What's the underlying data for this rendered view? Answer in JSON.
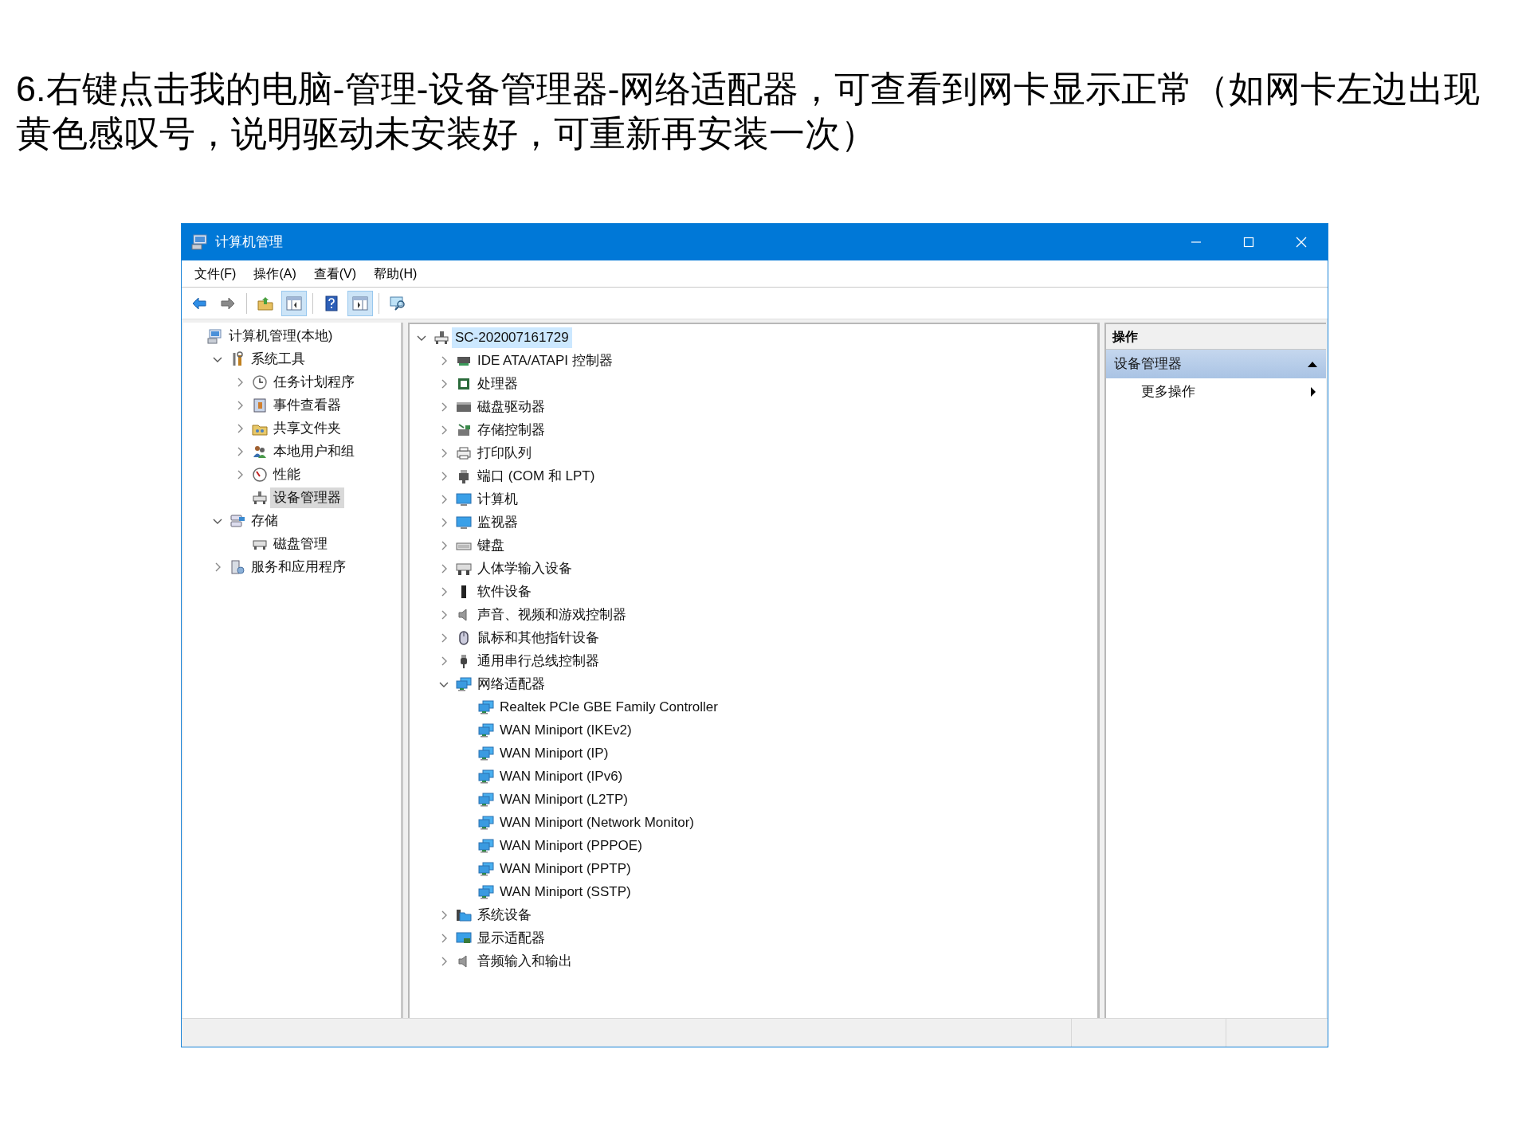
{
  "instruction": "6.右键点击我的电脑-管理-设备管理器-网络适配器，可查看到网卡显示正常（如网卡左边出现黄色感叹号，说明驱动未安装好，可重新再安装一次）",
  "window": {
    "title": "计算机管理"
  },
  "menu": [
    {
      "label": "文件(F)"
    },
    {
      "label": "操作(A)"
    },
    {
      "label": "查看(V)"
    },
    {
      "label": "帮助(H)"
    }
  ],
  "toolbar": [
    {
      "kind": "back",
      "pressed": false
    },
    {
      "kind": "forward",
      "pressed": false
    },
    {
      "kind": "separator"
    },
    {
      "kind": "up",
      "pressed": false
    },
    {
      "kind": "tree",
      "pressed": true
    },
    {
      "kind": "separator"
    },
    {
      "kind": "help",
      "pressed": false
    },
    {
      "kind": "action-pane",
      "pressed": true
    },
    {
      "kind": "separator"
    },
    {
      "kind": "scan",
      "pressed": false
    }
  ],
  "console_tree": [
    {
      "label": "计算机管理(本地)",
      "selected": false,
      "children": [
        {
          "label": "系统工具",
          "expanded": true,
          "selected": false,
          "children": [
            {
              "label": "任务计划程序",
              "expanded": false,
              "selected": false
            },
            {
              "label": "事件查看器",
              "expanded": false,
              "selected": false
            },
            {
              "label": "共享文件夹",
              "expanded": false,
              "selected": false
            },
            {
              "label": "本地用户和组",
              "expanded": false,
              "selected": false
            },
            {
              "label": "性能",
              "expanded": false,
              "selected": false
            },
            {
              "label": "设备管理器",
              "selected": true
            }
          ]
        },
        {
          "label": "存储",
          "expanded": true,
          "selected": false,
          "children": [
            {
              "label": "磁盘管理",
              "selected": false
            }
          ]
        },
        {
          "label": "服务和应用程序",
          "expanded": false,
          "selected": false
        }
      ]
    }
  ],
  "device_tree": [
    {
      "label": "SC-202007161729",
      "expanded": true,
      "selected": true,
      "children": [
        {
          "label": "IDE ATA/ATAPI 控制器",
          "expanded": false,
          "selected": false
        },
        {
          "label": "处理器",
          "expanded": false,
          "selected": false
        },
        {
          "label": "磁盘驱动器",
          "expanded": false,
          "selected": false
        },
        {
          "label": "存储控制器",
          "expanded": false,
          "selected": false
        },
        {
          "label": "打印队列",
          "expanded": false,
          "selected": false
        },
        {
          "label": "端口 (COM 和 LPT)",
          "expanded": false,
          "selected": false
        },
        {
          "label": "计算机",
          "expanded": false,
          "selected": false
        },
        {
          "label": "监视器",
          "expanded": false,
          "selected": false
        },
        {
          "label": "键盘",
          "expanded": false,
          "selected": false
        },
        {
          "label": "人体学输入设备",
          "expanded": false,
          "selected": false
        },
        {
          "label": "软件设备",
          "expanded": false,
          "selected": false
        },
        {
          "label": "声音、视频和游戏控制器",
          "expanded": false,
          "selected": false
        },
        {
          "label": "鼠标和其他指针设备",
          "expanded": false,
          "selected": false
        },
        {
          "label": "通用串行总线控制器",
          "expanded": false,
          "selected": false
        },
        {
          "label": "网络适配器",
          "expanded": true,
          "selected": false,
          "children": [
            {
              "label": "Realtek PCIe GBE Family Controller",
              "selected": false
            },
            {
              "label": "WAN Miniport (IKEv2)",
              "selected": false
            },
            {
              "label": "WAN Miniport (IP)",
              "selected": false
            },
            {
              "label": "WAN Miniport (IPv6)",
              "selected": false
            },
            {
              "label": "WAN Miniport (L2TP)",
              "selected": false
            },
            {
              "label": "WAN Miniport (Network Monitor)",
              "selected": false
            },
            {
              "label": "WAN Miniport (PPPOE)",
              "selected": false
            },
            {
              "label": "WAN Miniport (PPTP)",
              "selected": false
            },
            {
              "label": "WAN Miniport (SSTP)",
              "selected": false
            }
          ]
        },
        {
          "label": "系统设备",
          "expanded": false,
          "selected": false
        },
        {
          "label": "显示适配器",
          "expanded": false,
          "selected": false
        },
        {
          "label": "音频输入和输出",
          "expanded": false,
          "selected": false
        }
      ]
    }
  ],
  "actions": {
    "header": "操作",
    "section": {
      "label": "设备管理器",
      "expanded": true
    },
    "items": [
      {
        "label": "更多操作"
      }
    ]
  }
}
